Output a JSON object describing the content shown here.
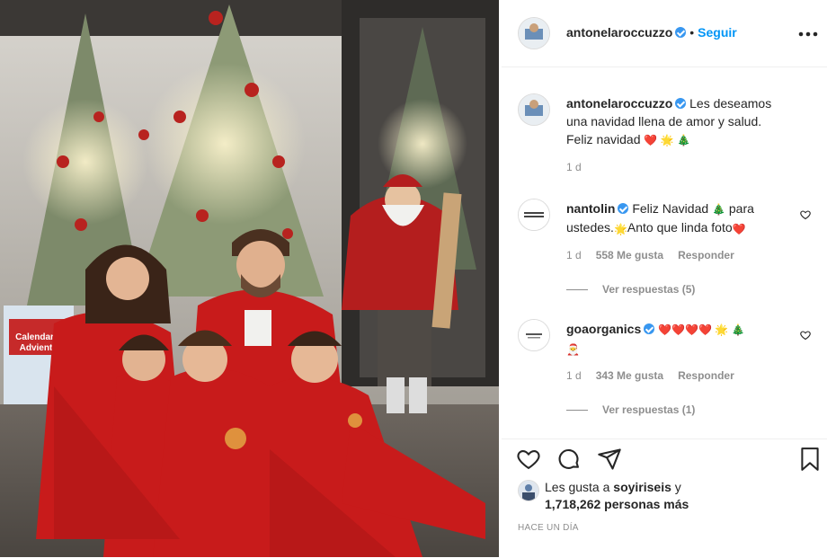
{
  "header": {
    "username": "antonelaroccuzzo",
    "separator": "•",
    "follow_label": "Seguir",
    "more_icon": "more-horizontal-icon"
  },
  "caption": {
    "username": "antonelaroccuzzo",
    "text_line1": "Les deseamos",
    "text_line2": "una navidad llena de amor y salud.",
    "text_line3": "Feliz navidad",
    "emojis": "❤️ 🌟 🎄",
    "time": "1 d"
  },
  "comments": [
    {
      "username": "nantolin",
      "text_line1": "Feliz Navidad",
      "emoji1": "🎄",
      "text_after1": "para",
      "text_line2a": "ustedes.",
      "emoji2": "🌟",
      "text_line2b": "Anto que linda foto",
      "emoji3": "❤️",
      "time": "1 d",
      "likes": "558 Me gusta",
      "reply": "Responder",
      "view_replies": "Ver respuestas (5)"
    },
    {
      "username": "goaorganics",
      "emojis": "❤️❤️❤️❤️ 🌟 🎄",
      "emoji_line2": "🎅",
      "time": "1 d",
      "likes": "343 Me gusta",
      "reply": "Responder",
      "view_replies": "Ver respuestas (1)"
    }
  ],
  "likes": {
    "prefix": "Les gusta a",
    "user": "soyiriseis",
    "conj": "y",
    "count": "1,718,262 personas más"
  },
  "timestamp": "HACE UN DÍA",
  "colors": {
    "link": "#0095f6",
    "verified": "#3897f0",
    "text": "#262626",
    "muted": "#8e8e8e"
  }
}
